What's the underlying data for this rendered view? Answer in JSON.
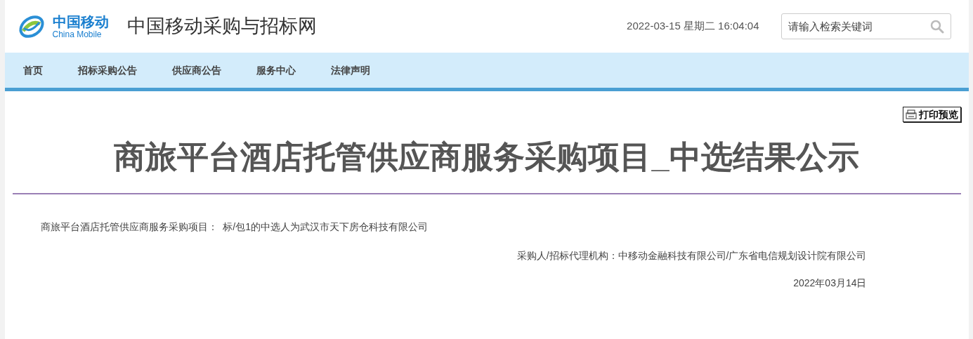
{
  "logo": {
    "name_cn": "中国移动",
    "name_en": "China Mobile"
  },
  "site_title": "中国移动采购与招标网",
  "datetime": "2022-03-15 星期二 16:04:04",
  "search": {
    "placeholder": "请输入检索关键词"
  },
  "nav": [
    {
      "label": "首页"
    },
    {
      "label": "招标采购公告"
    },
    {
      "label": "供应商公告"
    },
    {
      "label": "服务中心"
    },
    {
      "label": "法律声明"
    }
  ],
  "print_button": "打印预览",
  "article": {
    "title": "商旅平台酒店托管供应商服务采购项目_中选结果公示",
    "body": "商旅平台酒店托管供应商服务采购项目：  标/包1的中选人为武汉市天下房仓科技有限公司",
    "signature": "采购人/招标代理机构：中移动金融科技有限公司/广东省电信规划设计院有限公司",
    "date": "2022年03月14日"
  }
}
